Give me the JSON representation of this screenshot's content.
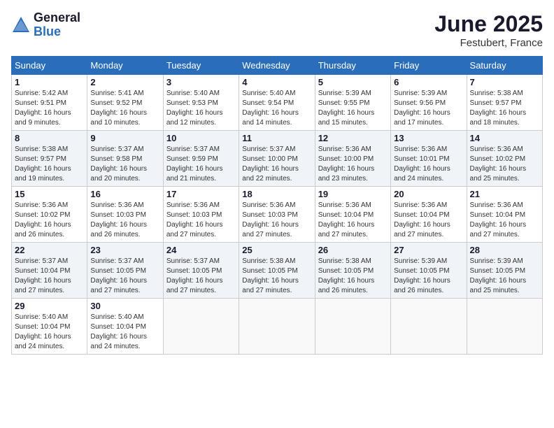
{
  "logo": {
    "general": "General",
    "blue": "Blue"
  },
  "header": {
    "month": "June 2025",
    "location": "Festubert, France"
  },
  "weekdays": [
    "Sunday",
    "Monday",
    "Tuesday",
    "Wednesday",
    "Thursday",
    "Friday",
    "Saturday"
  ],
  "weeks": [
    [
      {
        "day": "1",
        "text": "Sunrise: 5:42 AM\nSunset: 9:51 PM\nDaylight: 16 hours and 9 minutes."
      },
      {
        "day": "2",
        "text": "Sunrise: 5:41 AM\nSunset: 9:52 PM\nDaylight: 16 hours and 10 minutes."
      },
      {
        "day": "3",
        "text": "Sunrise: 5:40 AM\nSunset: 9:53 PM\nDaylight: 16 hours and 12 minutes."
      },
      {
        "day": "4",
        "text": "Sunrise: 5:40 AM\nSunset: 9:54 PM\nDaylight: 16 hours and 14 minutes."
      },
      {
        "day": "5",
        "text": "Sunrise: 5:39 AM\nSunset: 9:55 PM\nDaylight: 16 hours and 15 minutes."
      },
      {
        "day": "6",
        "text": "Sunrise: 5:39 AM\nSunset: 9:56 PM\nDaylight: 16 hours and 17 minutes."
      },
      {
        "day": "7",
        "text": "Sunrise: 5:38 AM\nSunset: 9:57 PM\nDaylight: 16 hours and 18 minutes."
      }
    ],
    [
      {
        "day": "8",
        "text": "Sunrise: 5:38 AM\nSunset: 9:57 PM\nDaylight: 16 hours and 19 minutes."
      },
      {
        "day": "9",
        "text": "Sunrise: 5:37 AM\nSunset: 9:58 PM\nDaylight: 16 hours and 20 minutes."
      },
      {
        "day": "10",
        "text": "Sunrise: 5:37 AM\nSunset: 9:59 PM\nDaylight: 16 hours and 21 minutes."
      },
      {
        "day": "11",
        "text": "Sunrise: 5:37 AM\nSunset: 10:00 PM\nDaylight: 16 hours and 22 minutes."
      },
      {
        "day": "12",
        "text": "Sunrise: 5:36 AM\nSunset: 10:00 PM\nDaylight: 16 hours and 23 minutes."
      },
      {
        "day": "13",
        "text": "Sunrise: 5:36 AM\nSunset: 10:01 PM\nDaylight: 16 hours and 24 minutes."
      },
      {
        "day": "14",
        "text": "Sunrise: 5:36 AM\nSunset: 10:02 PM\nDaylight: 16 hours and 25 minutes."
      }
    ],
    [
      {
        "day": "15",
        "text": "Sunrise: 5:36 AM\nSunset: 10:02 PM\nDaylight: 16 hours and 26 minutes."
      },
      {
        "day": "16",
        "text": "Sunrise: 5:36 AM\nSunset: 10:03 PM\nDaylight: 16 hours and 26 minutes."
      },
      {
        "day": "17",
        "text": "Sunrise: 5:36 AM\nSunset: 10:03 PM\nDaylight: 16 hours and 27 minutes."
      },
      {
        "day": "18",
        "text": "Sunrise: 5:36 AM\nSunset: 10:03 PM\nDaylight: 16 hours and 27 minutes."
      },
      {
        "day": "19",
        "text": "Sunrise: 5:36 AM\nSunset: 10:04 PM\nDaylight: 16 hours and 27 minutes."
      },
      {
        "day": "20",
        "text": "Sunrise: 5:36 AM\nSunset: 10:04 PM\nDaylight: 16 hours and 27 minutes."
      },
      {
        "day": "21",
        "text": "Sunrise: 5:36 AM\nSunset: 10:04 PM\nDaylight: 16 hours and 27 minutes."
      }
    ],
    [
      {
        "day": "22",
        "text": "Sunrise: 5:37 AM\nSunset: 10:04 PM\nDaylight: 16 hours and 27 minutes."
      },
      {
        "day": "23",
        "text": "Sunrise: 5:37 AM\nSunset: 10:05 PM\nDaylight: 16 hours and 27 minutes."
      },
      {
        "day": "24",
        "text": "Sunrise: 5:37 AM\nSunset: 10:05 PM\nDaylight: 16 hours and 27 minutes."
      },
      {
        "day": "25",
        "text": "Sunrise: 5:38 AM\nSunset: 10:05 PM\nDaylight: 16 hours and 27 minutes."
      },
      {
        "day": "26",
        "text": "Sunrise: 5:38 AM\nSunset: 10:05 PM\nDaylight: 16 hours and 26 minutes."
      },
      {
        "day": "27",
        "text": "Sunrise: 5:39 AM\nSunset: 10:05 PM\nDaylight: 16 hours and 26 minutes."
      },
      {
        "day": "28",
        "text": "Sunrise: 5:39 AM\nSunset: 10:05 PM\nDaylight: 16 hours and 25 minutes."
      }
    ],
    [
      {
        "day": "29",
        "text": "Sunrise: 5:40 AM\nSunset: 10:04 PM\nDaylight: 16 hours and 24 minutes."
      },
      {
        "day": "30",
        "text": "Sunrise: 5:40 AM\nSunset: 10:04 PM\nDaylight: 16 hours and 24 minutes."
      },
      {
        "day": "",
        "text": ""
      },
      {
        "day": "",
        "text": ""
      },
      {
        "day": "",
        "text": ""
      },
      {
        "day": "",
        "text": ""
      },
      {
        "day": "",
        "text": ""
      }
    ]
  ]
}
